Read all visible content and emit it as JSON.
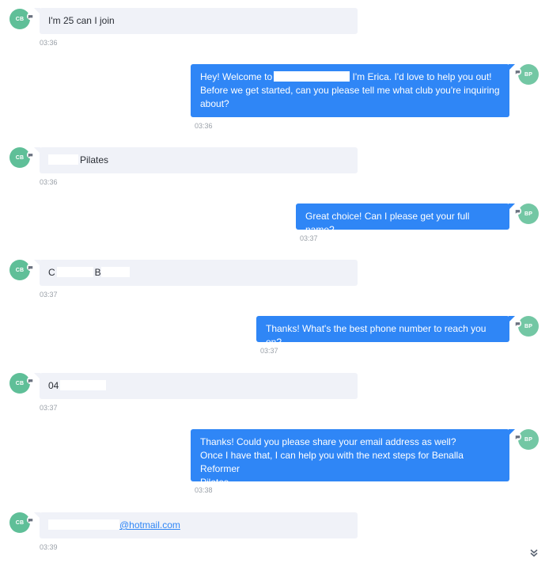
{
  "contact_initials": "CB",
  "agent_initials": "BP",
  "messages": [
    {
      "text": "I'm 25 can I join",
      "time": "03:36"
    },
    {
      "line1_pre": "Hey! Welcome to",
      "line1_post": " I'm Erica. I'd love to help you out!",
      "line2": "Before we get started, can you please tell me what club you're inquiring",
      "line3": "about?",
      "time": "03:36"
    },
    {
      "text": "Pilates",
      "time": "03:36"
    },
    {
      "text": "Great choice! Can I please get your full name?",
      "time": "03:37"
    },
    {
      "first_initial": "C",
      "last_initial": "B",
      "time": "03:37"
    },
    {
      "text": "Thanks! What's the best phone number to reach you on?",
      "time": "03:37"
    },
    {
      "text": "04",
      "time": "03:37"
    },
    {
      "line1": "Thanks! Could you please share your email address as well?",
      "line2": "Once I have that, I can help you with the next steps for Benalla Reformer",
      "line3": "Pilates.",
      "time": "03:38"
    },
    {
      "email_domain": "@hotmail.com",
      "time": "03:39"
    }
  ],
  "colors": {
    "agent_bubble": "#2f86f6",
    "contact_bubble": "#f0f2f8",
    "avatar": "#5fbf98"
  },
  "icons": {
    "avatar_badge": "chat-bubble-icon",
    "scroll": "double-chevron-down-icon"
  }
}
